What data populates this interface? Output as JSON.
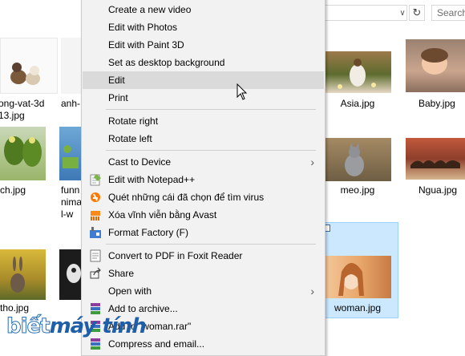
{
  "search": {
    "placeholder": "Search"
  },
  "files": [
    {
      "name": "ong-vat-3d\n13.jpg"
    },
    {
      "name": "anh-"
    },
    {
      "name": "Asia.jpg"
    },
    {
      "name": "Baby.jpg"
    },
    {
      "name": "ch.jpg"
    },
    {
      "name": "funn\nnima\nl-w"
    },
    {
      "name": "meo.jpg"
    },
    {
      "name": "Ngua.jpg"
    },
    {
      "name": "tho.jpg"
    },
    {
      "name": "woman.jpg"
    }
  ],
  "context_menu": {
    "items": [
      {
        "label": "Create a new video",
        "icon": "none"
      },
      {
        "label": "Edit with Photos",
        "icon": "none"
      },
      {
        "label": "Edit with Paint 3D",
        "icon": "none"
      },
      {
        "label": "Set as desktop background",
        "icon": "none"
      },
      {
        "label": "Edit",
        "icon": "none",
        "hovered": true
      },
      {
        "label": "Print",
        "icon": "none"
      },
      {
        "label": "Rotate right",
        "icon": "none"
      },
      {
        "label": "Rotate left",
        "icon": "none"
      },
      {
        "label": "Cast to Device",
        "icon": "none",
        "submenu": true
      },
      {
        "label": "Edit with Notepad++",
        "icon": "notepad-plus-plus-icon"
      },
      {
        "label": "Quét những cái đã chọn để tìm virus",
        "icon": "avast-icon"
      },
      {
        "label": "Xóa vĩnh viễn bằng Avast",
        "icon": "avast-shredder-icon"
      },
      {
        "label": "Format Factory (F)",
        "icon": "format-factory-icon"
      },
      {
        "label": "Convert to PDF in Foxit Reader",
        "icon": "foxit-icon"
      },
      {
        "label": "Share",
        "icon": "share-icon"
      },
      {
        "label": "Open with",
        "icon": "none",
        "submenu": true
      },
      {
        "label": "Add to archive...",
        "icon": "winrar-icon"
      },
      {
        "label": "Add to \"woman.rar\"",
        "icon": "winrar-icon"
      },
      {
        "label": "Compress and email...",
        "icon": "winrar-icon"
      }
    ]
  },
  "watermark": {
    "part1": "biết",
    "part2": "máy tính"
  },
  "colors": {
    "selection": "#cce8ff",
    "menu_bg": "#f2f2f2",
    "hover": "#dadada"
  }
}
